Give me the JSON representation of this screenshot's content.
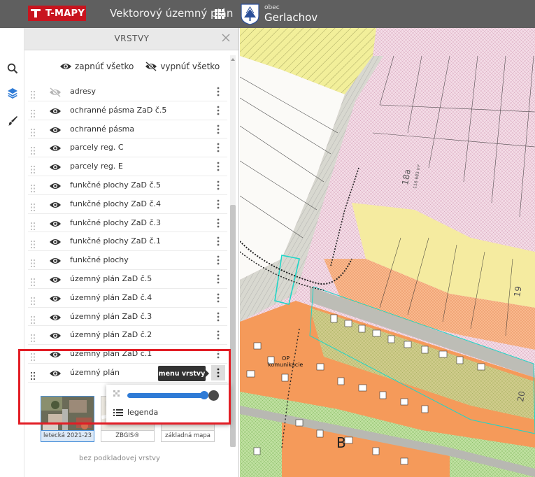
{
  "header": {
    "logo_text": "T-MAPY",
    "app_title": "Vektorový územný plán",
    "municipality_prefix": "obec",
    "municipality_name": "Gerlachov"
  },
  "panel": {
    "title": "VRSTVY",
    "show_all": "zapnúť všetko",
    "hide_all": "vypnúť všetko"
  },
  "layers": [
    {
      "name": "adresy",
      "visible": false
    },
    {
      "name": "ochranné pásma ZaD č.5",
      "visible": true
    },
    {
      "name": "ochranné pásma",
      "visible": true
    },
    {
      "name": "parcely reg. C",
      "visible": true
    },
    {
      "name": "parcely reg. E",
      "visible": true
    },
    {
      "name": "funkčné plochy ZaD č.5",
      "visible": true
    },
    {
      "name": "funkčné plochy ZaD č.4",
      "visible": true
    },
    {
      "name": "funkčné plochy ZaD č.3",
      "visible": true
    },
    {
      "name": "funkčné plochy ZaD č.1",
      "visible": true
    },
    {
      "name": "funkčné plochy",
      "visible": true
    },
    {
      "name": "územný plán ZaD č.5",
      "visible": true
    },
    {
      "name": "územný plán ZaD č.4",
      "visible": true
    },
    {
      "name": "územný plán ZaD č.3",
      "visible": true
    },
    {
      "name": "územný plán ZaD č.2",
      "visible": true
    },
    {
      "name": "územný plán ZaD č.1",
      "visible": true
    },
    {
      "name": "územný plán",
      "visible": true
    }
  ],
  "tooltip": "menu vrstvy",
  "layer_menu": {
    "legend_label": "legenda"
  },
  "basemaps": [
    {
      "label": "letecká 2021-23",
      "selected": true
    },
    {
      "label": "ZBGIS®",
      "selected": false
    },
    {
      "label": "základná mapa",
      "selected": false
    }
  ],
  "no_basemap": "bez podkladovej vrstvy",
  "map": {
    "labels": {
      "op": "OP",
      "komunikacie": "komunikácie",
      "parcel_18a": "18a",
      "parcel_18a_area": "116 683 m²",
      "parcel_19": "19",
      "parcel_20": "20",
      "zone_b": "B"
    }
  },
  "colors": {
    "topbar": "#5f5f5f",
    "brand_red": "#c8141e",
    "accent_blue": "#2f7bd6",
    "highlight_red": "#e21d25"
  }
}
